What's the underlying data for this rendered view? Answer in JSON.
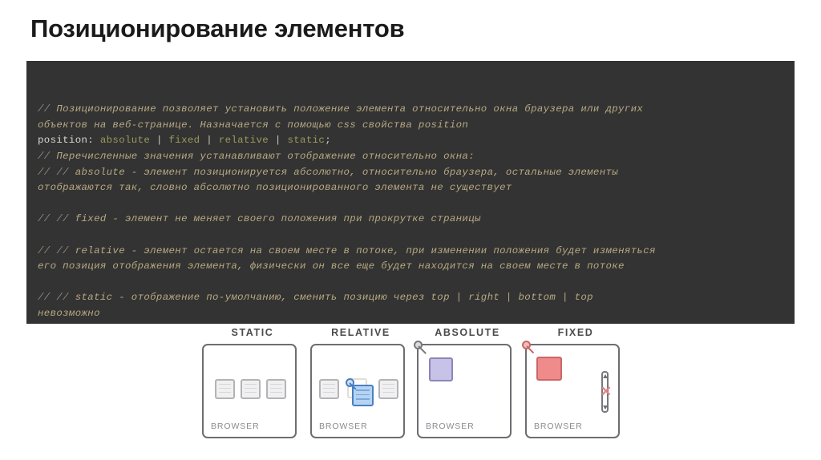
{
  "slide": {
    "title": "Позиционирование элементов"
  },
  "code": {
    "lines": [
      {
        "id": "l1",
        "segments": [
          {
            "cls": "cm",
            "text": "// "
          },
          {
            "cls": "tx",
            "text": "Позиционирование позволяет установить положение элемента относительно окна браузера или других"
          }
        ]
      },
      {
        "id": "l2",
        "segments": [
          {
            "cls": "tx",
            "text": "объектов на веб-странице. Назначается с помощью css свойства position"
          }
        ]
      },
      {
        "id": "l3",
        "segments": [
          {
            "cls": "kw",
            "text": "position: "
          },
          {
            "cls": "val",
            "text": "absolute"
          },
          {
            "cls": "pipe",
            "text": " | "
          },
          {
            "cls": "val",
            "text": "fixed"
          },
          {
            "cls": "pipe",
            "text": " | "
          },
          {
            "cls": "val",
            "text": "relative"
          },
          {
            "cls": "pipe",
            "text": " | "
          },
          {
            "cls": "val",
            "text": "static"
          },
          {
            "cls": "pipe",
            "text": ";"
          }
        ]
      },
      {
        "id": "l4",
        "segments": [
          {
            "cls": "cm",
            "text": "// "
          },
          {
            "cls": "tx",
            "text": "Перечисленные значения устанавливают отображение относительно окна:"
          }
        ]
      },
      {
        "id": "l5",
        "segments": [
          {
            "cls": "cm",
            "text": "// // "
          },
          {
            "cls": "tx",
            "text": "absolute - элемент позиционируется абсолютно, относительно браузера, остальные элементы"
          }
        ]
      },
      {
        "id": "l6",
        "segments": [
          {
            "cls": "tx",
            "text": "отображаются так, словно абсолютно позиционированного элемента не существует"
          }
        ]
      },
      {
        "id": "l7",
        "blank": true,
        "segments": [
          {
            "cls": "tx",
            "text": " "
          }
        ]
      },
      {
        "id": "l8",
        "segments": [
          {
            "cls": "cm",
            "text": "// // "
          },
          {
            "cls": "tx",
            "text": "fixed - элемент не меняет своего положения при прокрутке страницы"
          }
        ]
      },
      {
        "id": "l9",
        "blank": true,
        "segments": [
          {
            "cls": "tx",
            "text": " "
          }
        ]
      },
      {
        "id": "l10",
        "segments": [
          {
            "cls": "cm",
            "text": "// // "
          },
          {
            "cls": "tx",
            "text": "relative - элемент остается на своем месте в потоке, при изменении положения будет изменяться"
          }
        ]
      },
      {
        "id": "l11",
        "segments": [
          {
            "cls": "tx",
            "text": "его позиция отображения элемента, физически он все еще будет находится на своем месте в потоке"
          }
        ]
      },
      {
        "id": "l12",
        "blank": true,
        "segments": [
          {
            "cls": "tx",
            "text": " "
          }
        ]
      },
      {
        "id": "l13",
        "segments": [
          {
            "cls": "cm",
            "text": "// // "
          },
          {
            "cls": "tx",
            "text": "static - отображение по-умолчанию, сменить позицию через top | right | bottom | top"
          }
        ]
      },
      {
        "id": "l14",
        "segments": [
          {
            "cls": "tx",
            "text": "невозможно"
          }
        ]
      }
    ]
  },
  "diagrams": {
    "browser_caption": "BROWSER",
    "columns": [
      {
        "key": "static",
        "label": "STATIC"
      },
      {
        "key": "relative",
        "label": "RELATIVE"
      },
      {
        "key": "absolute",
        "label": "ABSOLUTE"
      },
      {
        "key": "fixed",
        "label": "FIXED"
      }
    ],
    "fixed_scroll_disabled_mark": "✕"
  },
  "colors": {
    "code_background": "#333333",
    "code_comment": "#b8a983",
    "code_keyword": "#d8d8d2",
    "code_value": "#9a9a5e",
    "slide_background": "#ffffff",
    "browser_outline": "#6d6d72",
    "relative_accent": "#4a7fc1",
    "absolute_accent": "#8b86b8",
    "fixed_accent": "#c96767"
  }
}
